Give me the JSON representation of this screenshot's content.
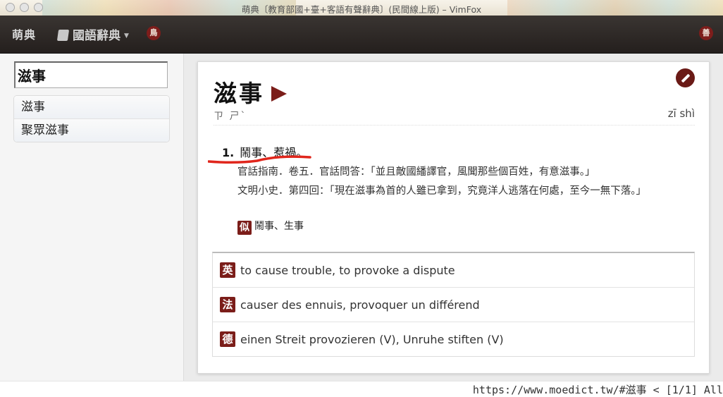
{
  "window": {
    "title": "萌典〔教育部國+臺+客語有聲辭典〕(民間線上版) – VimFox"
  },
  "navbar": {
    "brand": "萌典",
    "dictionary_label": "國語辭典",
    "lang_seal": "鳥",
    "right_seal": "善"
  },
  "search": {
    "value": "滋事"
  },
  "results": [
    {
      "label": "滋事"
    },
    {
      "label": "聚眾滋事"
    }
  ],
  "entry": {
    "headword": "滋事",
    "bopomofo": "ㄗ ㄕˋ",
    "pinyin": "zī shì",
    "definitions": [
      {
        "number": "1.",
        "text": "鬧事、惹禍。",
        "examples": [
          "官話指南．卷五．官話問答：「並且敵國繙譯官，風聞那些個百姓，有意滋事。」",
          "文明小史．第四回：「現在滋事為首的人雖已拿到，究竟洋人逃落在何處，至今一無下落。」"
        ],
        "synonym_tag": "似",
        "synonyms": "鬧事、生事"
      }
    ],
    "translations": [
      {
        "tag": "英",
        "text": "to cause trouble, to provoke a dispute"
      },
      {
        "tag": "法",
        "text": "causer des ennuis, provoquer un différend"
      },
      {
        "tag": "德",
        "text": "einen Streit provozieren (V), Unruhe stiften (V)"
      }
    ]
  },
  "statusline": {
    "text": "https://www.moedict.tw/#滋事 < [1/1] All"
  },
  "colors": {
    "accent": "#7b1d19",
    "navbar": "#2e2926",
    "annotation": "#e0261c"
  }
}
